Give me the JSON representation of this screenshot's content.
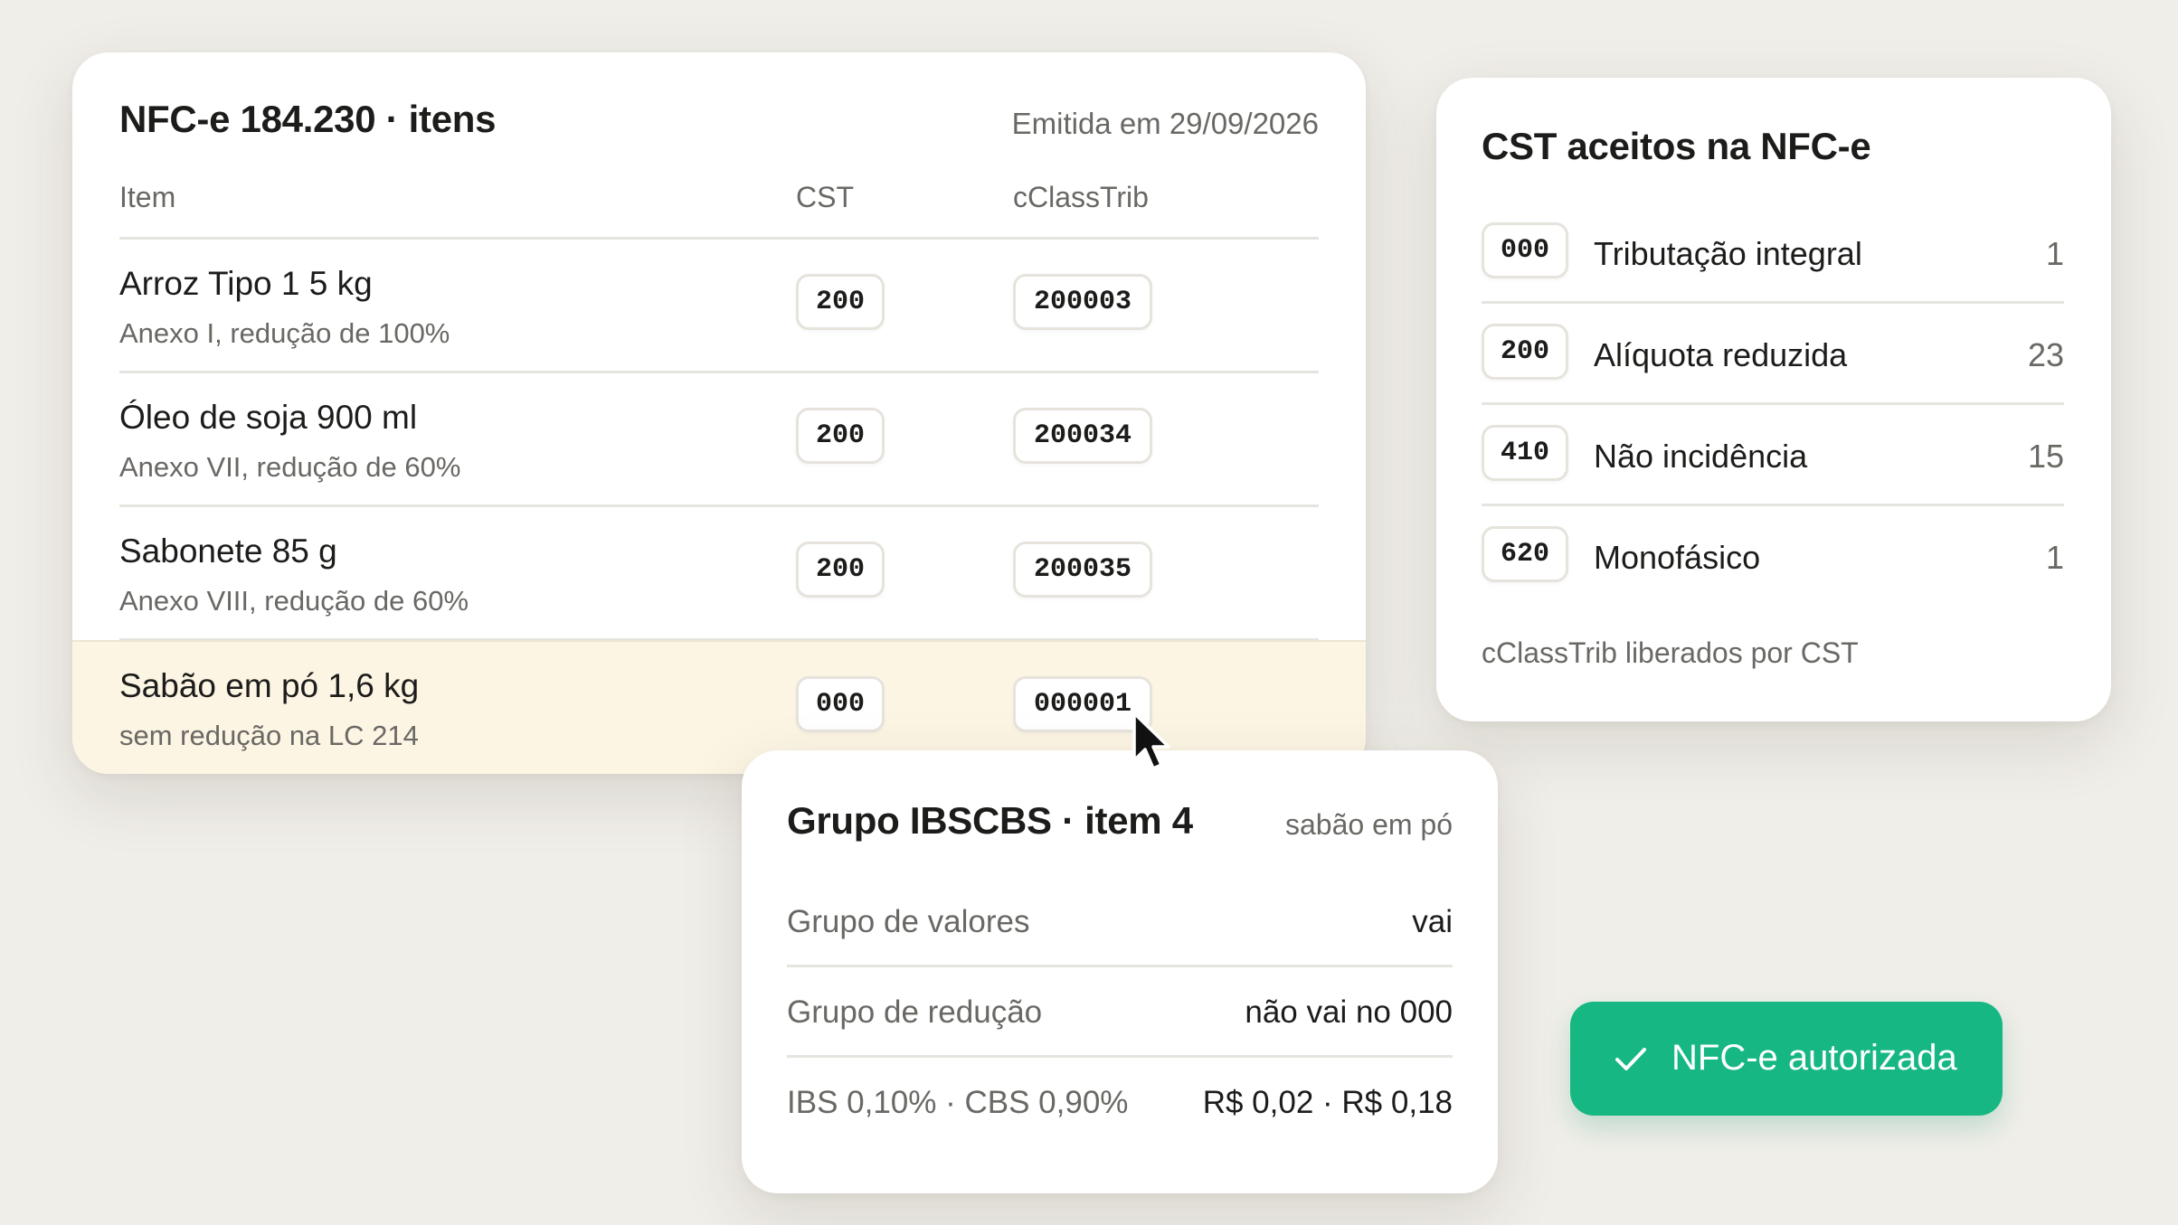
{
  "items_card": {
    "title": "NFC-e 184.230 · itens",
    "emitted": "Emitida em 29/09/2026",
    "columns": {
      "item": "Item",
      "cst": "CST",
      "cclasstrib": "cClassTrib"
    },
    "rows": [
      {
        "name": "Arroz Tipo 1 5 kg",
        "desc": "Anexo I, redução de 100%",
        "cst": "200",
        "cclasstrib": "200003"
      },
      {
        "name": "Óleo de soja 900 ml",
        "desc": "Anexo VII, redução de 60%",
        "cst": "200",
        "cclasstrib": "200034"
      },
      {
        "name": "Sabonete 85 g",
        "desc": "Anexo VIII, redução de 60%",
        "cst": "200",
        "cclasstrib": "200035"
      },
      {
        "name": "Sabão em pó 1,6 kg",
        "desc": "sem redução na LC 214",
        "cst": "000",
        "cclasstrib": "000001"
      }
    ],
    "highlight_color": "#fcf5e4"
  },
  "cst_card": {
    "title": "CST aceitos na NFC-e",
    "rows": [
      {
        "code": "000",
        "label": "Tributação integral",
        "count": "1"
      },
      {
        "code": "200",
        "label": "Alíquota reduzida",
        "count": "23"
      },
      {
        "code": "410",
        "label": "Não incidência",
        "count": "15"
      },
      {
        "code": "620",
        "label": "Monofásico",
        "count": "1"
      }
    ],
    "footnote": "cClassTrib liberados por CST"
  },
  "ibs_card": {
    "title": "Grupo IBSCBS · item 4",
    "subtitle": "sabão em pó",
    "rows": [
      {
        "label": "Grupo de valores",
        "value": "vai"
      },
      {
        "label": "Grupo de redução",
        "value": "não vai no 000"
      },
      {
        "label": "IBS 0,10% · CBS 0,90%",
        "value": "R$ 0,02 · R$ 0,18"
      }
    ]
  },
  "status_button": {
    "label": "NFC-e autorizada",
    "icon": "check-icon",
    "color": "#16b783"
  },
  "cursor": {
    "icon": "cursor-arrow-icon"
  }
}
